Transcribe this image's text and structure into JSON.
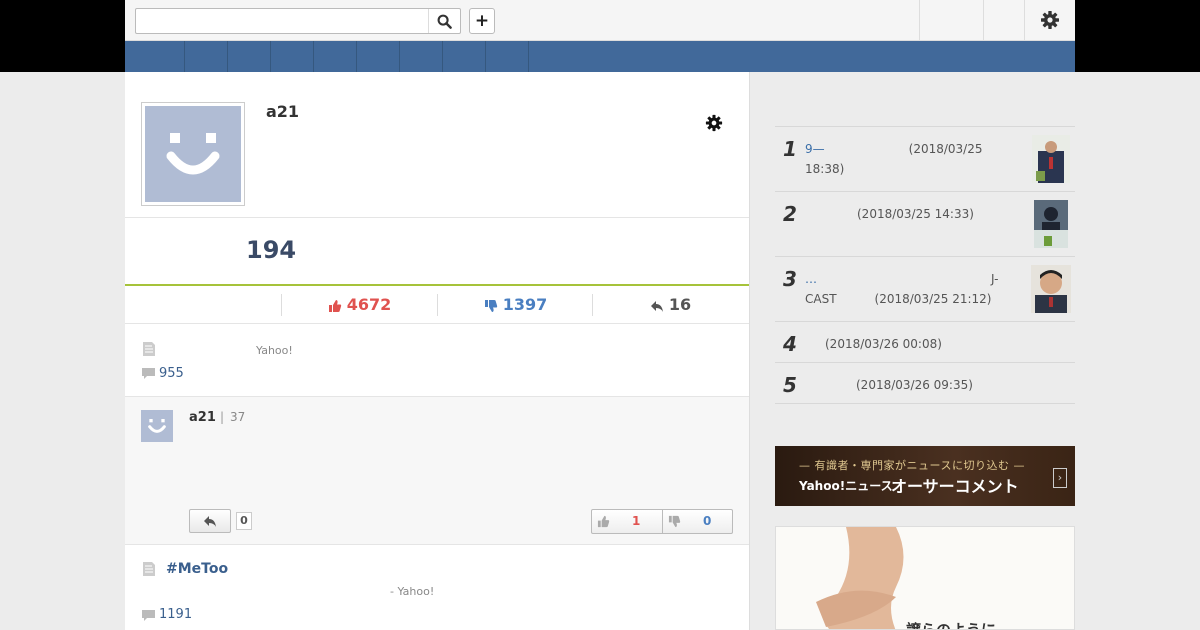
{
  "search": {
    "placeholder": "",
    "value": ""
  },
  "topbar": {
    "plus_label": "+"
  },
  "profile": {
    "username": "a21",
    "count": "194",
    "likes": "4672",
    "dislikes": "1397",
    "replies": "16"
  },
  "items": [
    {
      "source": "Yahoo!",
      "comments": "955"
    },
    {
      "title": "#MeToo",
      "source": "- Yahoo!",
      "comments": "1191"
    }
  ],
  "comment": {
    "username": "a21",
    "separator": "|",
    "number": "37",
    "reply_count": "0",
    "likes": "1",
    "dislikes": "0"
  },
  "ranking": [
    {
      "rank": "1",
      "link": "9—",
      "line1": "(2018/03/25",
      "line2": "18:38)"
    },
    {
      "rank": "2",
      "line1": "(2018/03/25 14:33)"
    },
    {
      "rank": "3",
      "link": "…",
      "suffix": "J-",
      "line2a": "CAST",
      "line2b": "(2018/03/25 21:12)"
    },
    {
      "rank": "4",
      "line1": "(2018/03/26 00:08)"
    },
    {
      "rank": "5",
      "line1": "(2018/03/26 09:35)"
    }
  ],
  "banner": {
    "subtitle": "— 有識者・専門家がニュースに切り込む —",
    "brand": "Yahoo!ニュース",
    "title": "オーサーコメント",
    "arrow": "›"
  },
  "ad": {
    "text": "譲らのように"
  },
  "colors": {
    "nav": "#41699a",
    "like": "#e0524f",
    "dislike": "#4a7fc1",
    "accent_line": "#a6c33a"
  },
  "icons": [
    "search-icon",
    "gear-icon",
    "thumbs-up-icon",
    "thumbs-down-icon",
    "reply-icon",
    "document-icon",
    "comment-icon"
  ]
}
